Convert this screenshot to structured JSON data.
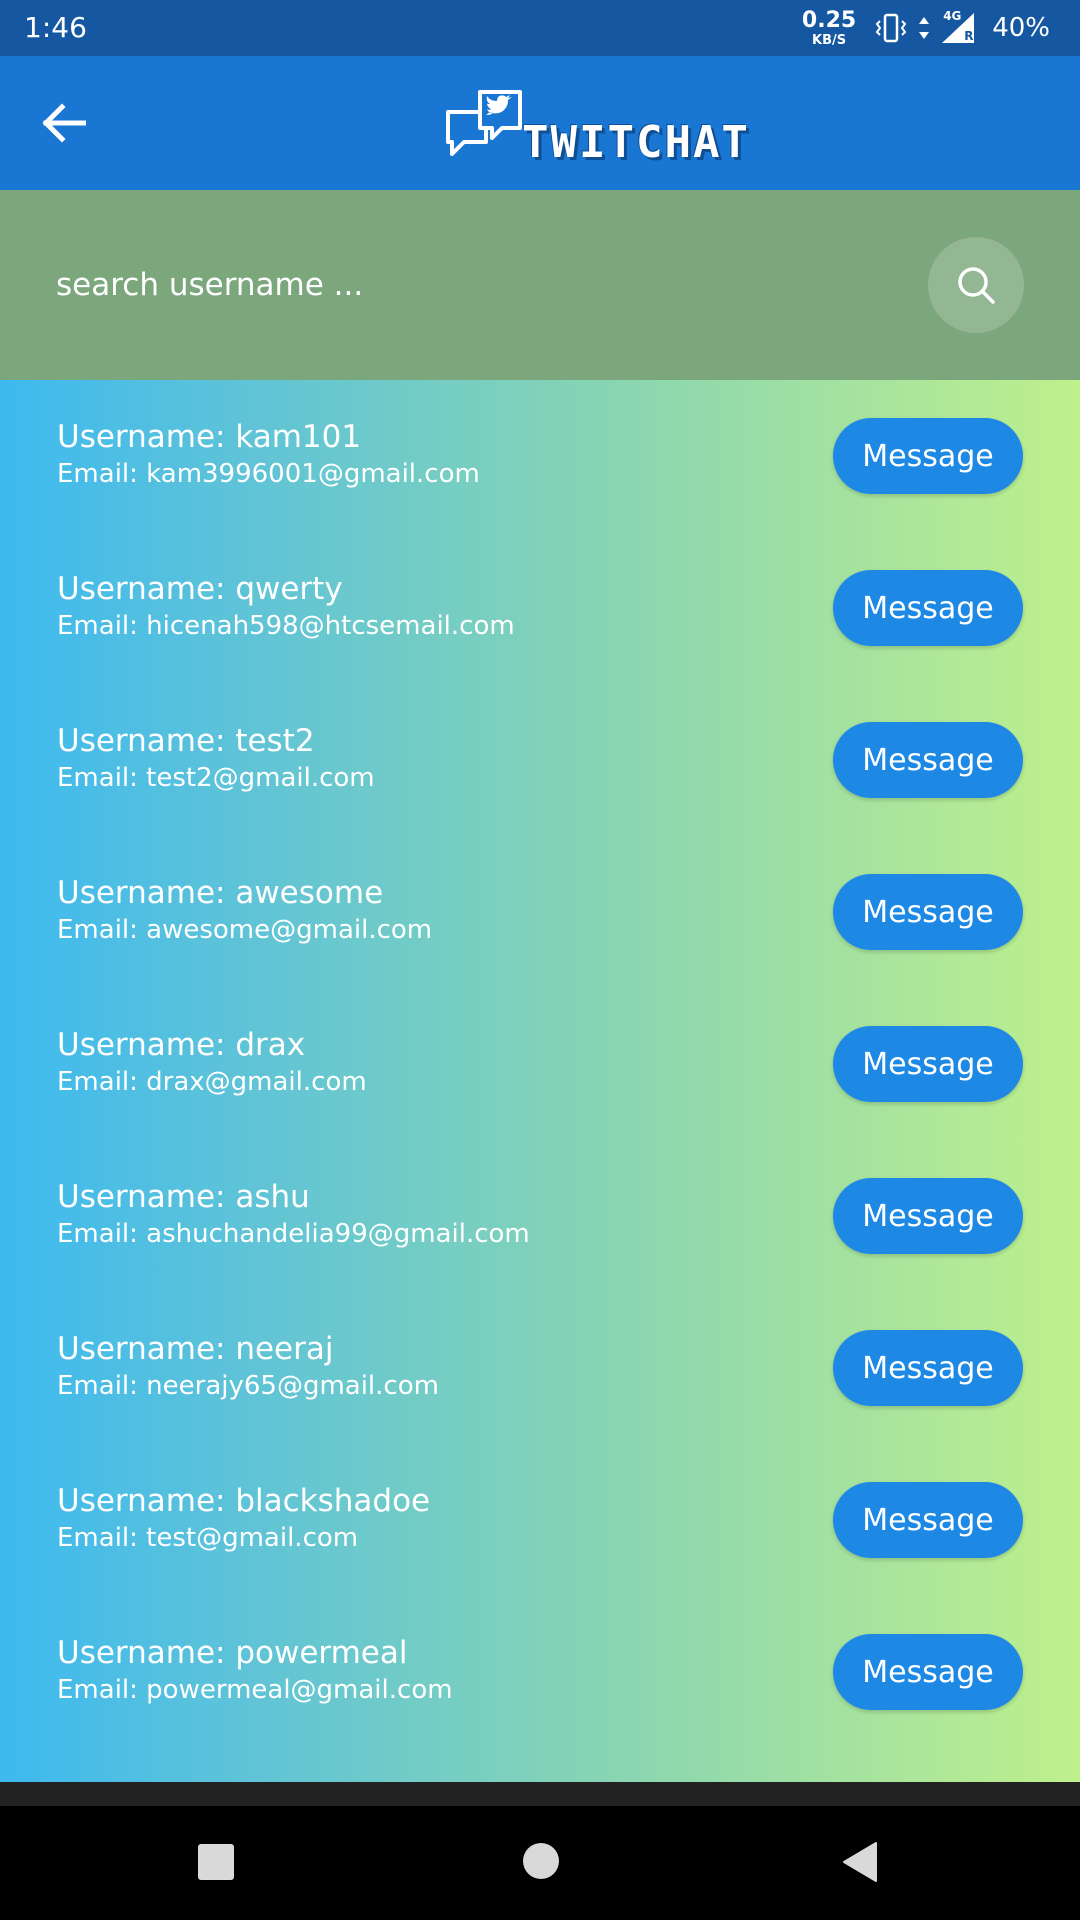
{
  "status_bar": {
    "time": "1:46",
    "net_speed_value": "0.25",
    "net_speed_unit": "KB/S",
    "network_type": "4G",
    "roaming": "R",
    "battery": "40%",
    "icons": [
      "vibrate-icon",
      "data-arrows-icon",
      "signal-icon"
    ]
  },
  "app_bar": {
    "back_icon": "arrow-back-icon",
    "logo_text": "TWITCHAT",
    "logo_icon": "chat-bubbles-bird-icon"
  },
  "search": {
    "placeholder": "search username ...",
    "value": "",
    "icon": "search-icon"
  },
  "users": [
    {
      "username": "Username: kam101",
      "email": "Email: kam3996001@gmail.com",
      "button": "Message"
    },
    {
      "username": "Username: qwerty",
      "email": "Email: hicenah598@htcsemail.com",
      "button": "Message"
    },
    {
      "username": "Username: test2",
      "email": "Email: test2@gmail.com",
      "button": "Message"
    },
    {
      "username": "Username: awesome",
      "email": "Email: awesome@gmail.com",
      "button": "Message"
    },
    {
      "username": "Username: drax",
      "email": "Email: drax@gmail.com",
      "button": "Message"
    },
    {
      "username": "Username: ashu",
      "email": "Email: ashuchandelia99@gmail.com",
      "button": "Message"
    },
    {
      "username": "Username: neeraj",
      "email": "Email: neerajy65@gmail.com",
      "button": "Message"
    },
    {
      "username": "Username: blackshadoe",
      "email": "Email: test@gmail.com",
      "button": "Message"
    },
    {
      "username": "Username: powermeal",
      "email": "Email: powermeal@gmail.com",
      "button": "Message"
    }
  ],
  "colors": {
    "status_bar": "#1557a0",
    "app_bar": "#1976d2",
    "search_area": "#7ca67c",
    "gradient_start": "#3db9ef",
    "gradient_end": "#bff08c",
    "message_button": "#1e88e5"
  },
  "nav_bar": {
    "icons": [
      "recent-apps-icon",
      "home-icon",
      "back-icon"
    ]
  }
}
